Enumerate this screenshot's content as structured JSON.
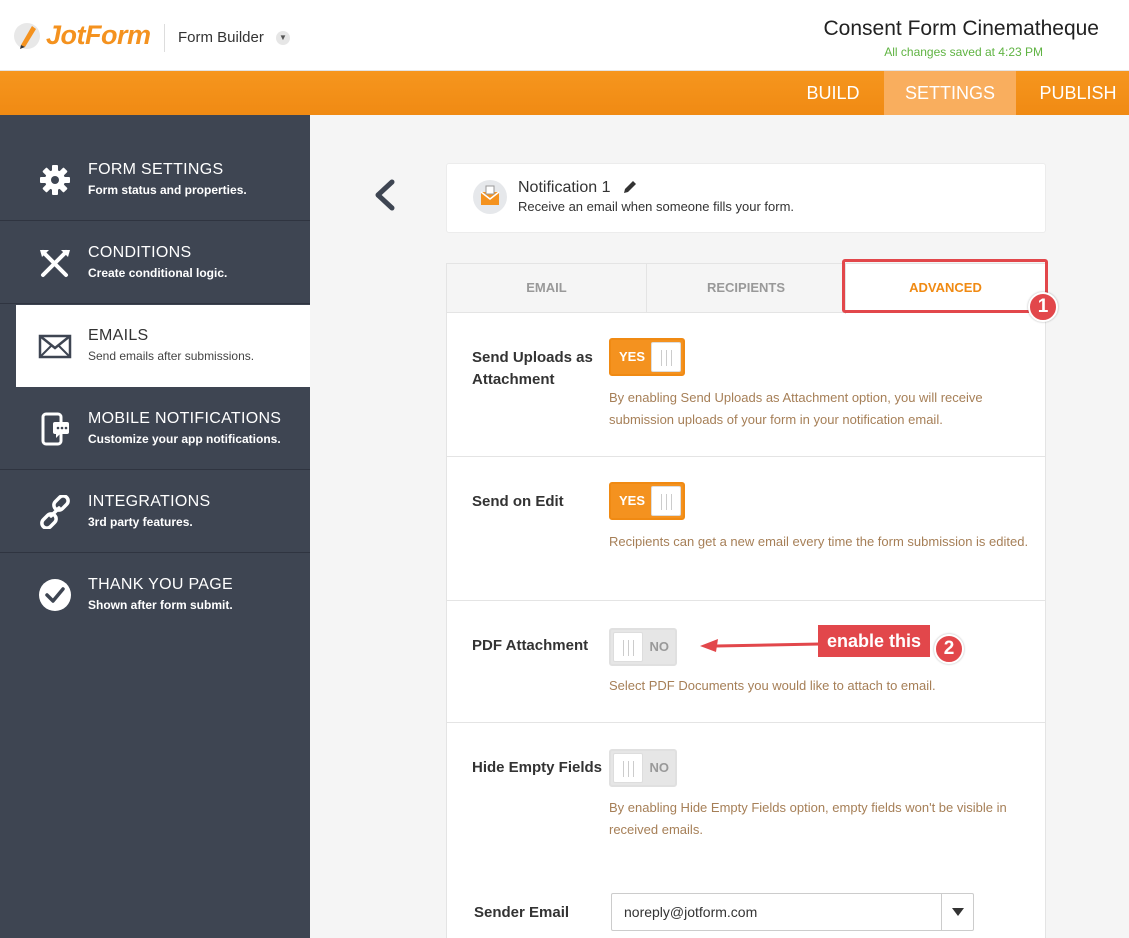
{
  "header": {
    "logo_text": "JotForm",
    "builder_label": "Form Builder",
    "form_title": "Consent Form Cinematheque",
    "save_status": "All changes saved at 4:23 PM"
  },
  "nav": {
    "tabs": [
      {
        "label": "BUILD",
        "active": false
      },
      {
        "label": "SETTINGS",
        "active": true
      },
      {
        "label": "PUBLISH",
        "active": false
      }
    ]
  },
  "sidebar": {
    "items": [
      {
        "title": "FORM SETTINGS",
        "desc": "Form status and properties.",
        "icon": "gear-icon",
        "active": false
      },
      {
        "title": "CONDITIONS",
        "desc": "Create conditional logic.",
        "icon": "conditions-icon",
        "active": false
      },
      {
        "title": "EMAILS",
        "desc": "Send emails after submissions.",
        "icon": "envelope-icon",
        "active": true
      },
      {
        "title": "MOBILE NOTIFICATIONS",
        "desc": "Customize your app notifications.",
        "icon": "mobile-icon",
        "active": false
      },
      {
        "title": "INTEGRATIONS",
        "desc": "3rd party features.",
        "icon": "link-icon",
        "active": false
      },
      {
        "title": "THANK YOU PAGE",
        "desc": "Shown after form submit.",
        "icon": "check-circle-icon",
        "active": false
      }
    ]
  },
  "notification": {
    "title": "Notification 1",
    "desc": "Receive an email when someone fills your form."
  },
  "panel": {
    "tabs": [
      {
        "label": "EMAIL",
        "active": false
      },
      {
        "label": "RECIPIENTS",
        "active": false
      },
      {
        "label": "ADVANCED",
        "active": true
      }
    ],
    "settings": [
      {
        "label": "Send Uploads as Attachment",
        "toggle": "YES",
        "on": true,
        "help": "By enabling Send Uploads as Attachment option, you will receive submission uploads of your form in your notification email."
      },
      {
        "label": "Send on Edit",
        "toggle": "YES",
        "on": true,
        "help": "Recipients can get a new email every time the form submission is edited."
      },
      {
        "label": "PDF Attachment",
        "toggle": "NO",
        "on": false,
        "help": "Select PDF Documents you would like to attach to email."
      },
      {
        "label": "Hide Empty Fields",
        "toggle": "NO",
        "on": false,
        "help": "By enabling Hide Empty Fields option, empty fields won't be visible in received emails."
      }
    ],
    "sender_email": {
      "label": "Sender Email",
      "value": "noreply@jotform.com"
    }
  },
  "annotations": {
    "badge1": "1",
    "badge2": "2",
    "callout": "enable this"
  },
  "colors": {
    "brand_orange": "#f4921f",
    "sidebar_bg": "#3e4552",
    "annotation_red": "#e2474b",
    "status_green": "#5fb342"
  }
}
